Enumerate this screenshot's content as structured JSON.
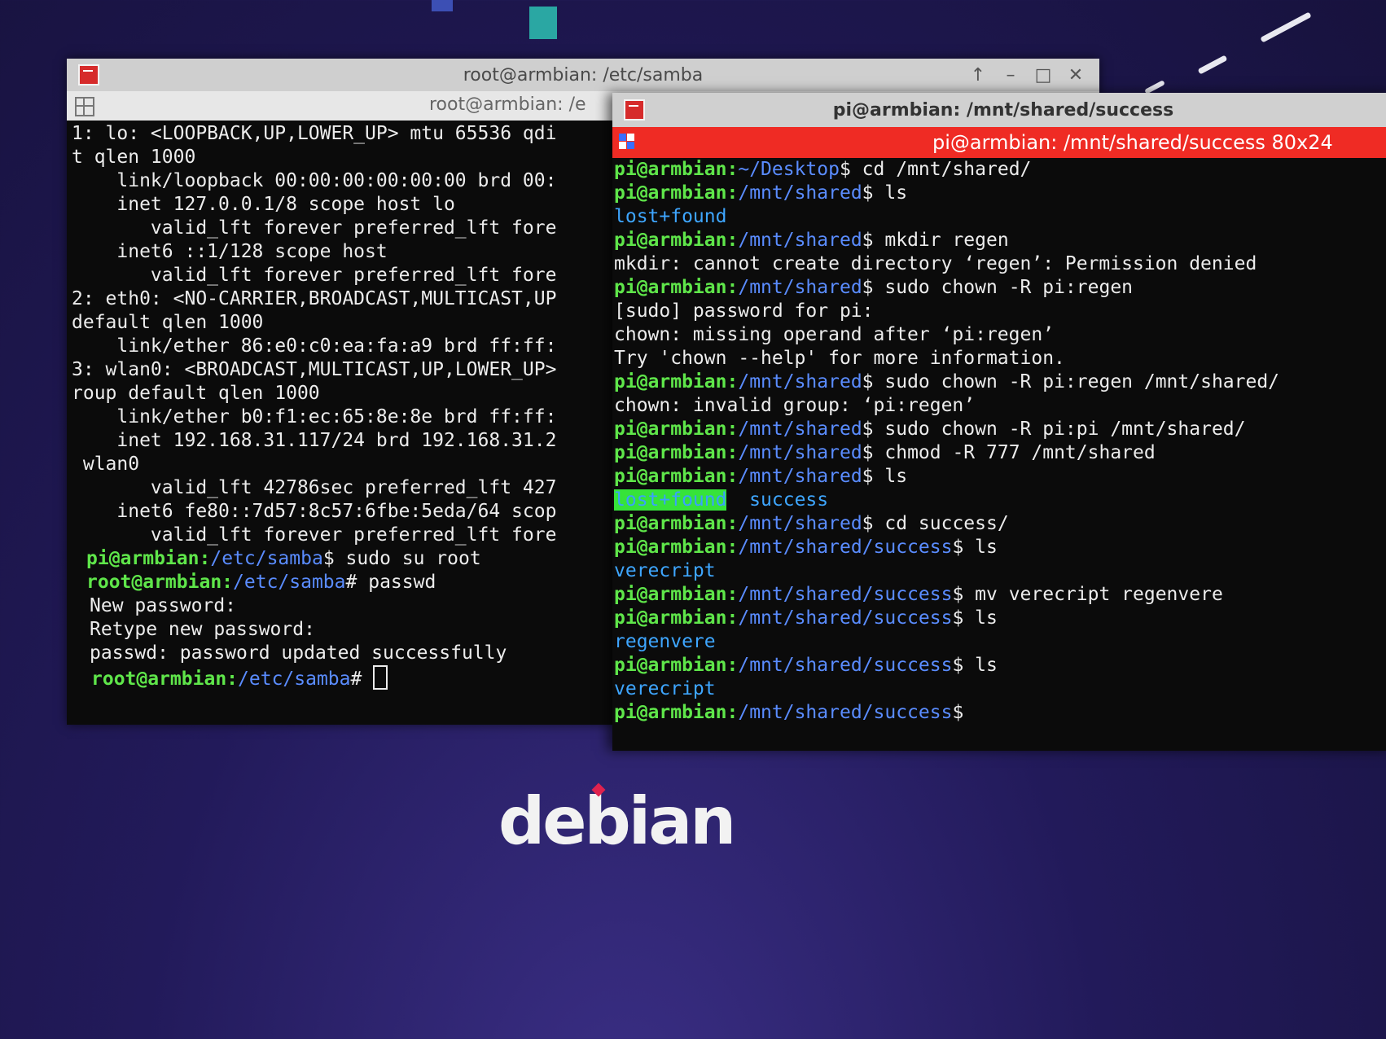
{
  "left_window": {
    "title": "root@armbian: /etc/samba",
    "tab_title": "root@armbian: /e",
    "buttons": {
      "up": "↑",
      "minimize": "–",
      "maximize": "□",
      "close": "✕"
    },
    "lines": [
      "1: lo: <LOOPBACK,UP,LOWER_UP> mtu 65536 qdi",
      "t qlen 1000",
      "    link/loopback 00:00:00:00:00:00 brd 00:",
      "    inet 127.0.0.1/8 scope host lo",
      "       valid_lft forever preferred_lft fore",
      "    inet6 ::1/128 scope host",
      "       valid_lft forever preferred_lft fore",
      "2: eth0: <NO-CARRIER,BROADCAST,MULTICAST,UP",
      "default qlen 1000",
      "    link/ether 86:e0:c0:ea:fa:a9 brd ff:ff:",
      "3: wlan0: <BROADCAST,MULTICAST,UP,LOWER_UP>",
      "roup default qlen 1000",
      "    link/ether b0:f1:ec:65:8e:8e brd ff:ff:",
      "    inet 192.168.31.117/24 brd 192.168.31.2",
      " wlan0",
      "       valid_lft 42786sec preferred_lft 427",
      "    inet6 fe80::7d57:8c57:6fbe:5eda/64 scop",
      "       valid_lft forever preferred_lft fore"
    ],
    "session": [
      {
        "user": "pi@armbian",
        "path": "/etc/samba",
        "sym": "$",
        "cmd": " sudo su root"
      },
      {
        "user": "root@armbian",
        "path": "/etc/samba",
        "sym": "#",
        "cmd": " passwd"
      }
    ],
    "output": [
      "New password:",
      "Retype new password:",
      "passwd: password updated successfully"
    ],
    "final_prompt": {
      "user": "root@armbian",
      "path": "/etc/samba",
      "sym": "#"
    }
  },
  "right_window": {
    "title": "pi@armbian: /mnt/shared/success",
    "tab_title": "pi@armbian: /mnt/shared/success 80x24",
    "lines": [
      {
        "user": "pi@armbian",
        "path": "~/Desktop",
        "sym": "$",
        "cmd": " cd /mnt/shared/"
      },
      {
        "user": "pi@armbian",
        "path": "/mnt/shared",
        "sym": "$",
        "cmd": " ls"
      },
      {
        "dir": "lost+found"
      },
      {
        "user": "pi@armbian",
        "path": "/mnt/shared",
        "sym": "$",
        "cmd": " mkdir regen"
      },
      {
        "text": "mkdir: cannot create directory ‘regen’: Permission denied"
      },
      {
        "user": "pi@armbian",
        "path": "/mnt/shared",
        "sym": "$",
        "cmd": " sudo chown -R pi:regen"
      },
      {
        "text": "[sudo] password for pi:"
      },
      {
        "text": "chown: missing operand after ‘pi:regen’"
      },
      {
        "text": "Try 'chown --help' for more information."
      },
      {
        "user": "pi@armbian",
        "path": "/mnt/shared",
        "sym": "$",
        "cmd": " sudo chown -R pi:regen /mnt/shared/"
      },
      {
        "text": "chown: invalid group: ‘pi:regen’"
      },
      {
        "user": "pi@armbian",
        "path": "/mnt/shared",
        "sym": "$",
        "cmd": " sudo chown -R pi:pi /mnt/shared/"
      },
      {
        "user": "pi@armbian",
        "path": "/mnt/shared",
        "sym": "$",
        "cmd": " chmod -R 777 /mnt/shared"
      },
      {
        "user": "pi@armbian",
        "path": "/mnt/shared",
        "sym": "$",
        "cmd": " ls"
      },
      {
        "hl": "lost+found",
        "dir": "  success"
      },
      {
        "user": "pi@armbian",
        "path": "/mnt/shared",
        "sym": "$",
        "cmd": " cd success/"
      },
      {
        "user": "pi@armbian",
        "path": "/mnt/shared/success",
        "sym": "$",
        "cmd": " ls"
      },
      {
        "dir": "verecript"
      },
      {
        "user": "pi@armbian",
        "path": "/mnt/shared/success",
        "sym": "$",
        "cmd": " mv verecript regenvere"
      },
      {
        "user": "pi@armbian",
        "path": "/mnt/shared/success",
        "sym": "$",
        "cmd": " ls"
      },
      {
        "dir": "regenvere"
      },
      {
        "user": "pi@armbian",
        "path": "/mnt/shared/success",
        "sym": "$",
        "cmd": " ls"
      },
      {
        "dir": "verecript"
      },
      {
        "user": "pi@armbian",
        "path": "/mnt/shared/success",
        "sym": "$",
        "cmd": ""
      }
    ]
  },
  "desktop": {
    "logo": "debian",
    "colors": {
      "prompt_user": "#5fe64a",
      "prompt_path": "#5a8cff",
      "dir": "#3ea6ff",
      "accent_bar": "#ef2b24"
    }
  }
}
